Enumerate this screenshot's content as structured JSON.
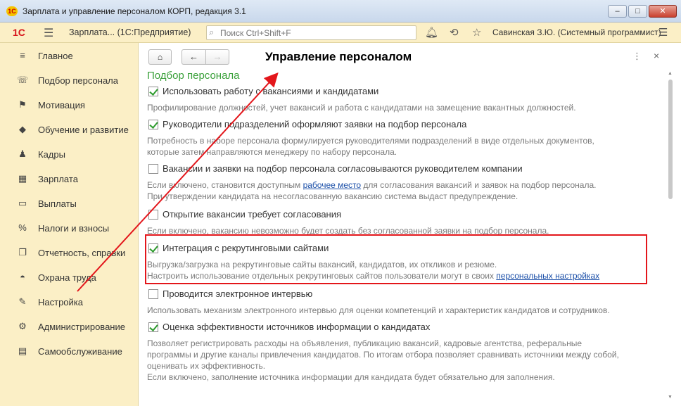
{
  "window": {
    "title": "Зарплата и управление персоналом КОРП, редакция 3.1",
    "logo_text": "1С",
    "min": "‒",
    "max": "□",
    "close": "✕"
  },
  "toolbar": {
    "logo": "1С",
    "menu_icon": "☰",
    "app_name": "Зарплата...  (1С:Предприятие)",
    "search_icon": "⌕",
    "search_placeholder": "Поиск Ctrl+Shift+F",
    "bell_icon": "🔔︎",
    "history_icon": "⟲",
    "star_icon": "☆",
    "user": "Савинская З.Ю. (Системный программист)",
    "settings_icon": "☰"
  },
  "sidebar": {
    "items": [
      {
        "icon": "≡",
        "label": "Главное"
      },
      {
        "icon": "☏",
        "label": "Подбор персонала"
      },
      {
        "icon": "⚑",
        "label": "Мотивация"
      },
      {
        "icon": "◆",
        "label": "Обучение и развитие"
      },
      {
        "icon": "♟",
        "label": "Кадры"
      },
      {
        "icon": "▦",
        "label": "Зарплата"
      },
      {
        "icon": "▭",
        "label": "Выплаты"
      },
      {
        "icon": "%",
        "label": "Налоги и взносы"
      },
      {
        "icon": "❐",
        "label": "Отчетность, справки"
      },
      {
        "icon": "◓",
        "label": "Охрана труда"
      },
      {
        "icon": "✎",
        "label": "Настройка"
      },
      {
        "icon": "⚙",
        "label": "Администрирование"
      },
      {
        "icon": "▤",
        "label": "Самообслуживание"
      }
    ]
  },
  "main": {
    "home_icon": "⌂",
    "back_icon": "←",
    "forward_icon": "→",
    "page_title": "Управление персоналом",
    "more_icon": "⋮",
    "close_icon": "×",
    "section_title": "Подбор персонала",
    "options": [
      {
        "label": "Использовать работу с вакансиями и кандидатами",
        "checked": true,
        "desc1": "Профилирование должностей, учет вакансий и работа с кандидатами на замещение вакантных должностей."
      },
      {
        "label": "Руководители подразделений оформляют заявки на подбор персонала",
        "checked": true,
        "desc1": "Потребность в наборе персонала формулируется руководителями подразделений в виде отдельных документов,",
        "desc2": "которые затем направляются менеджеру по набору персонала."
      },
      {
        "label": "Вакансии и заявки на подбор персонала согласовываются руководителем компании",
        "checked": false,
        "desc1_pre": "Если включено, становится доступным ",
        "desc1_link": "рабочее место",
        "desc1_post": " для согласования вакансий и заявок на подбор персонала.",
        "desc2": "При утверждении кандидата на несогласованную вакансию система выдаст предупреждение."
      },
      {
        "label": "Открытие вакансии требует согласования",
        "checked": false,
        "desc1": "Если включено, вакансию невозможно будет создать без согласованной заявки на подбор персонала."
      },
      {
        "label": "Интеграция с рекрутинговыми сайтами",
        "checked": true,
        "desc1": "Выгрузка/загрузка на рекрутинговые сайты вакансий, кандидатов, их откликов и резюме.",
        "desc2_pre": "Настроить использование отдельных рекрутинговых сайтов пользователи могут в своих ",
        "desc2_link": "персональных настройках"
      },
      {
        "label": "Проводится электронное интервью",
        "checked": false,
        "desc1": "Использовать механизм электронного интервью для оценки компетенций и характеристик кандидатов и сотрудников."
      },
      {
        "label": "Оценка эффективности источников информации о кандидатах",
        "checked": true,
        "desc1": "Позволяет регистрировать расходы на объявления, публикацию вакансий, кадровые агентства, реферальные",
        "desc2": "программы и другие каналы привлечения кандидатов. По итогам отбора позволяет сравнивать источники между собой,",
        "desc3": "оценивать их эффективность.",
        "desc4": "Если включено, заполнение источника информации для кандидата будет обязательно для заполнения."
      }
    ]
  },
  "colors": {
    "accent_yellow": "#fbefc6",
    "section_green": "#3aa03a",
    "highlight_red": "#e3161b",
    "link_blue": "#1b4fa8"
  }
}
